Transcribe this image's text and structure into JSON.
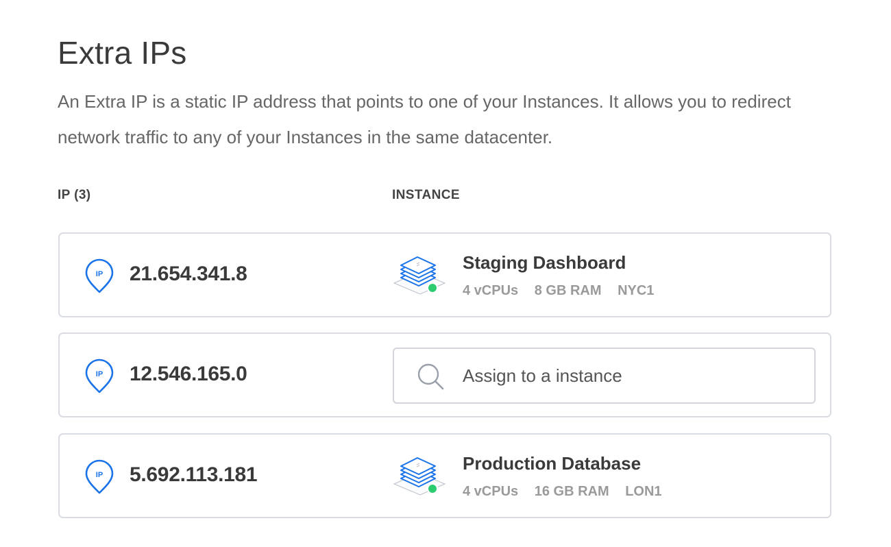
{
  "header": {
    "title": "Extra IPs",
    "description": "An Extra IP is a static IP address that points to one of your Instances. It allows you to redirect network traffic to any of your Instances in the same datacenter."
  },
  "table": {
    "columns": {
      "ip": "IP (3)",
      "instance": "INSTANCE"
    },
    "rows": [
      {
        "ip": "21.654.341.8",
        "instance": {
          "name": "Staging Dashboard",
          "cpus": "4 vCPUs",
          "ram": "8 GB RAM",
          "region": "NYC1",
          "status_color": "#2ecc71"
        }
      },
      {
        "ip": "12.546.165.0",
        "assign": {
          "placeholder": "Assign to a instance"
        }
      },
      {
        "ip": "5.692.113.181",
        "instance": {
          "name": "Production Database",
          "cpus": "4 vCPUs",
          "ram": "16 GB RAM",
          "region": "LON1",
          "status_color": "#2ecc71"
        }
      }
    ]
  },
  "icons": {
    "ip": "ip-pin-icon",
    "instance": "server-stack-icon",
    "search": "search-icon"
  },
  "colors": {
    "accent": "#1a73e8",
    "status_active": "#2ecc71",
    "border": "#d9dce3"
  }
}
